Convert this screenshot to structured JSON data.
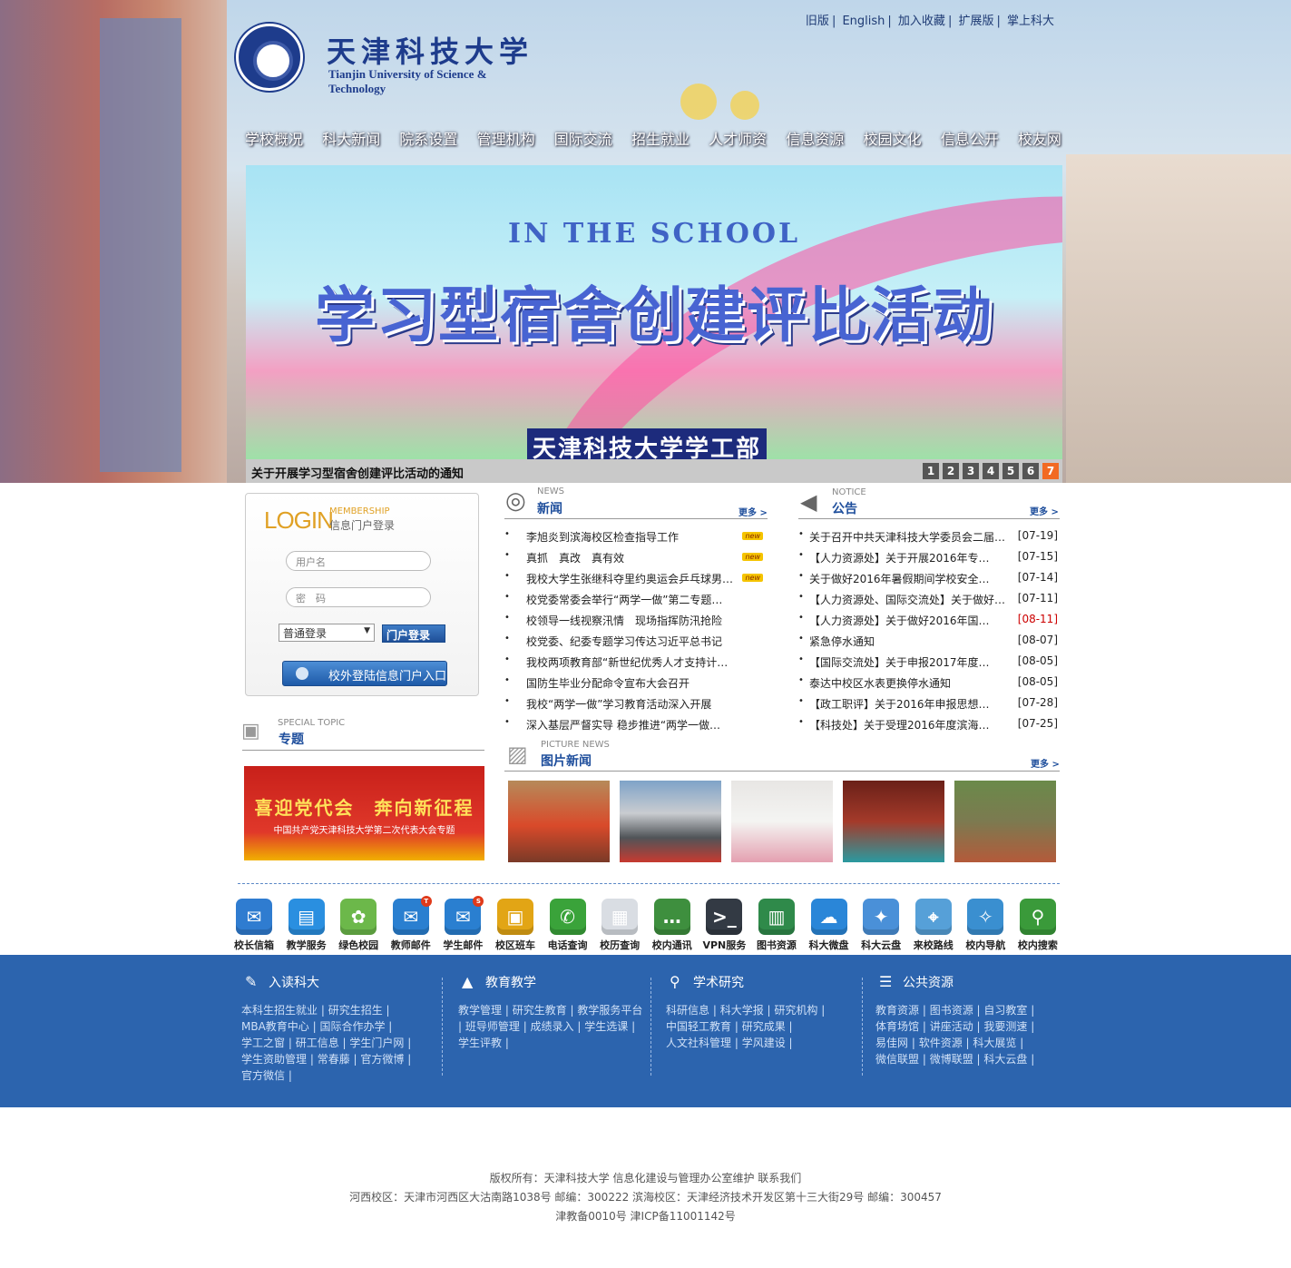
{
  "topnav": [
    "旧版",
    "English",
    "加入收藏",
    "扩展版",
    "掌上科大"
  ],
  "logo": {
    "cn": "天津科技大学",
    "en": "Tianjin University of Science & Technology"
  },
  "mainnav": [
    "学校概况",
    "科大新闻",
    "院系设置",
    "管理机构",
    "国际交流",
    "招生就业",
    "人才师资",
    "信息资源",
    "校园文化",
    "信息公开",
    "校友网"
  ],
  "banner": {
    "subtitle": "IN THE SCHOOL",
    "title": "学习型宿舍创建评比活动",
    "footer": "天津科技大学学工部",
    "caption": "关于开展学习型宿舍创建评比活动的通知",
    "pages": [
      "1",
      "2",
      "3",
      "4",
      "5",
      "6",
      "7"
    ],
    "active_page": "7"
  },
  "login": {
    "big": "LOGIN",
    "membership": "MEMBERSHIP",
    "subtitle": "信息门户登录",
    "username_placeholder": "用户名",
    "password_placeholder": "密　码",
    "mode": "普通登录",
    "login_btn": "门户登录",
    "outside_btn": "校外登陆信息门户入口"
  },
  "topic": {
    "en": "SPECIAL TOPIC",
    "cn": "专题",
    "line1": "喜迎党代会　奔向新征程",
    "line2": "中国共产党天津科技大学第二次代表大会专题"
  },
  "news": {
    "en": "NEWS",
    "cn": "新闻",
    "more": "更多 >",
    "new_tag": "new",
    "items": [
      {
        "t": "李旭炎到滨海校区检查指导工作",
        "new": true
      },
      {
        "t": "真抓　真改　真有效",
        "new": true
      },
      {
        "t": "我校大学生张继科夺里约奥运会乒乓球男…",
        "new": true
      },
      {
        "t": "校党委常委会举行“两学一做”第二专题…",
        "new": false
      },
      {
        "t": "校领导一线视察汛情　现场指挥防汛抢险",
        "new": false
      },
      {
        "t": "校党委、纪委专题学习传达习近平总书记",
        "new": false
      },
      {
        "t": "我校两项教育部“新世纪优秀人才支持计…",
        "new": false
      },
      {
        "t": "国防生毕业分配命令宣布大会召开",
        "new": false
      },
      {
        "t": "我校“两学一做”学习教育活动深入开展",
        "new": false
      },
      {
        "t": "深入基层严督实导 稳步推进“两学一做…",
        "new": false
      }
    ]
  },
  "notice": {
    "en": "NOTICE",
    "cn": "公告",
    "more": "更多 >",
    "items": [
      {
        "t": "关于召开中共天津科技大学委员会二届…",
        "d": "[07-19]",
        "red": false
      },
      {
        "t": "【人力资源处】关于开展2016年专…",
        "d": "[07-15]",
        "red": false
      },
      {
        "t": "关于做好2016年暑假期间学校安全…",
        "d": "[07-14]",
        "red": false
      },
      {
        "t": "【人力资源处、国际交流处】关于做好…",
        "d": "[07-11]",
        "red": false
      },
      {
        "t": "【人力资源处】关于做好2016年国…",
        "d": "[08-11]",
        "red": true
      },
      {
        "t": "紧急停水通知",
        "d": "[08-07]",
        "red": false
      },
      {
        "t": "【国际交流处】关于申报2017年度…",
        "d": "[08-05]",
        "red": false
      },
      {
        "t": "泰达中校区水表更换停水通知",
        "d": "[08-05]",
        "red": false
      },
      {
        "t": "【政工职评】关于2016年申报思想…",
        "d": "[07-28]",
        "red": false
      },
      {
        "t": "【科技处】关于受理2016年度滨海…",
        "d": "[07-25]",
        "red": false
      }
    ]
  },
  "picnews": {
    "en": "PICTURE NEWS",
    "cn": "图片新闻",
    "more": "更多 >"
  },
  "apps": [
    {
      "label": "校长信箱",
      "icon": "mail-icon",
      "color": "#2f7cd0",
      "glyph": "✉",
      "badge": ""
    },
    {
      "label": "教学服务",
      "icon": "document-icon",
      "color": "#2a8fe0",
      "glyph": "▤",
      "badge": ""
    },
    {
      "label": "绿色校园",
      "icon": "flower-icon",
      "color": "#6cb84a",
      "glyph": "✿",
      "badge": ""
    },
    {
      "label": "教师邮件",
      "icon": "envelope-icon",
      "color": "#2a7fd0",
      "glyph": "✉",
      "badge": "T"
    },
    {
      "label": "学生邮件",
      "icon": "envelope-icon",
      "color": "#2a7fd0",
      "glyph": "✉",
      "badge": "S"
    },
    {
      "label": "校区班车",
      "icon": "bus-icon",
      "color": "#e2a515",
      "glyph": "▣",
      "badge": ""
    },
    {
      "label": "电话查询",
      "icon": "phone-icon",
      "color": "#3aa33a",
      "glyph": "✆",
      "badge": ""
    },
    {
      "label": "校历查询",
      "icon": "calendar-icon",
      "color": "#d9dde3",
      "glyph": "▦",
      "badge": ""
    },
    {
      "label": "校内通讯",
      "icon": "chat-icon",
      "color": "#3e8f3e",
      "glyph": "…",
      "badge": ""
    },
    {
      "label": "VPN服务",
      "icon": "terminal-icon",
      "color": "#333a44",
      "glyph": ">_",
      "badge": ""
    },
    {
      "label": "图书资源",
      "icon": "books-icon",
      "color": "#2f8a4a",
      "glyph": "▥",
      "badge": ""
    },
    {
      "label": "科大微盘",
      "icon": "cloud-icon",
      "color": "#2a86d8",
      "glyph": "☁",
      "badge": ""
    },
    {
      "label": "科大云盘",
      "icon": "cloud-share-icon",
      "color": "#4a90d8",
      "glyph": "✦",
      "badge": ""
    },
    {
      "label": "来校路线",
      "icon": "map-icon",
      "color": "#56a0d8",
      "glyph": "⌖",
      "badge": ""
    },
    {
      "label": "校内导航",
      "icon": "compass-icon",
      "color": "#3a8fd0",
      "glyph": "✧",
      "badge": ""
    },
    {
      "label": "校内搜索",
      "icon": "search-icon",
      "color": "#3a9a3a",
      "glyph": "⚲",
      "badge": ""
    }
  ],
  "footer": [
    {
      "title": "入读科大",
      "icon": "book-icon",
      "glyph": "✎",
      "links": [
        "本科生招生就业",
        "研究生招生",
        "MBA教育中心",
        "国际合作办学",
        "学工之窗",
        "研工信息",
        "学生门户网",
        "学生资助管理",
        "常春藤",
        "官方微博",
        "官方微信"
      ]
    },
    {
      "title": "教育教学",
      "icon": "building-icon",
      "glyph": "▲",
      "links": [
        "教学管理",
        "研究生教育",
        "教学服务平台",
        "班导师管理",
        "成绩录入",
        "学生选课",
        "学生评教"
      ]
    },
    {
      "title": "学术研究",
      "icon": "magnifier-icon",
      "glyph": "⚲",
      "links": [
        "科研信息",
        "科大学报",
        "研究机构",
        "中国轻工教育",
        "研究成果",
        "人文社科管理",
        "学风建设"
      ]
    },
    {
      "title": "公共资源",
      "icon": "list-icon",
      "glyph": "☰",
      "links": [
        "教育资源",
        "图书资源",
        "自习教室",
        "体育场馆",
        "讲座活动",
        "我要测速",
        "易佳网",
        "软件资源",
        "科大展览",
        "微信联盟",
        "微博联盟",
        "科大云盘"
      ]
    }
  ],
  "copyright": {
    "line1": "版权所有：天津科技大学 信息化建设与管理办公室维护 联系我们",
    "line2": "河西校区：天津市河西区大沽南路1038号 邮编：300222 滨海校区：天津经济技术开发区第十三大街29号 邮编：300457",
    "line3": "津教备0010号 津ICP备11001142号"
  }
}
